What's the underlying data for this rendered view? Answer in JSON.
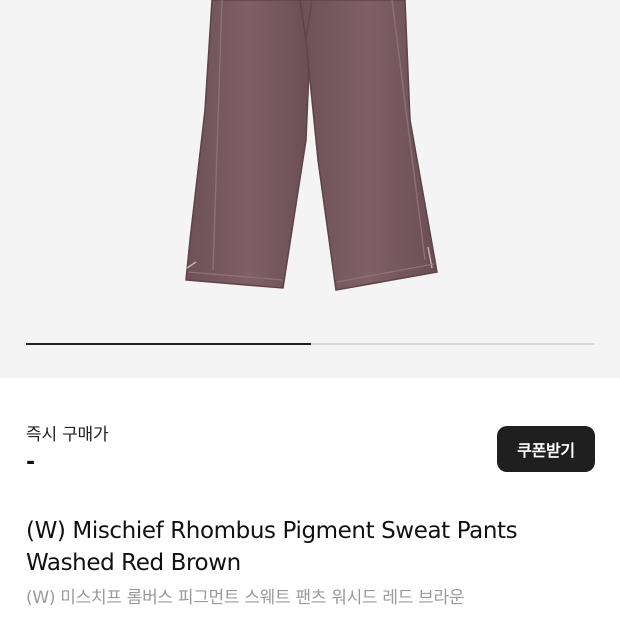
{
  "hero": {
    "image": "product-image-pants",
    "background": "#f4f4f4",
    "pants_color": "#7a5c61",
    "carousel_progress": 0.5
  },
  "price": {
    "label": "즉시 구매가",
    "value": "-"
  },
  "coupon": {
    "label": "쿠폰받기"
  },
  "product": {
    "title_line1": "(W) Mischief Rhombus Pigment Sweat Pants",
    "title_line2": "Washed Red Brown",
    "subtitle": "(W) 미스치프 롬버스 피그먼트 스웨트 팬츠 워시드 레드 브라운"
  }
}
